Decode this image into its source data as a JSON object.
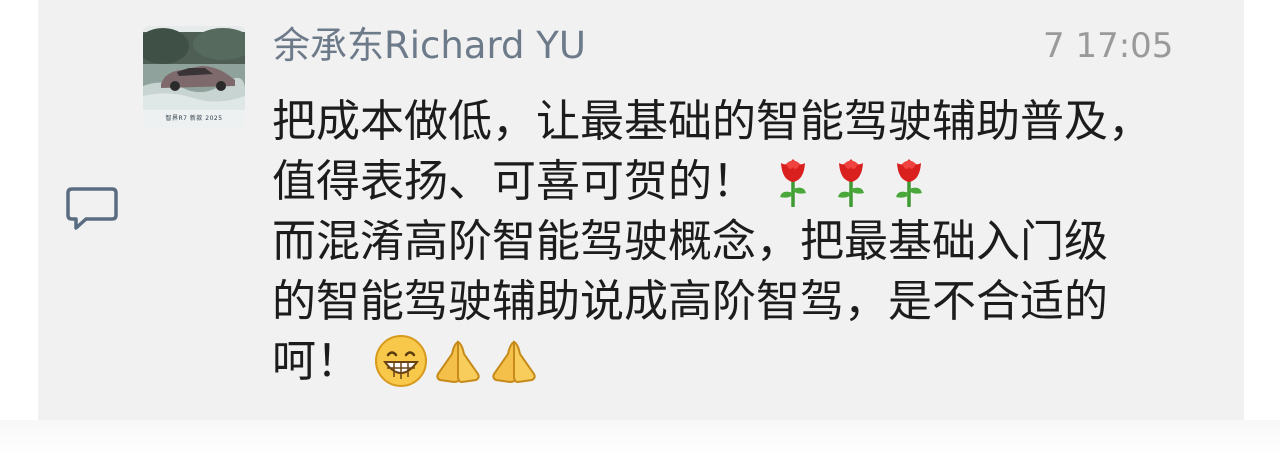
{
  "post": {
    "sender_name": "余承东Richard YU",
    "time": "7 17:05",
    "avatar_caption": "智界R7 新款 2025",
    "message_lines": [
      "把成本做低，让最基础的智能驾驶辅助普及，",
      "值得表扬、可喜可贺的！",
      "而混淆高阶智能驾驶概念，把最基础入门级",
      "的智能驾驶辅助说成高阶智驾，是不合适的",
      "呵！"
    ]
  },
  "icons": {
    "avatar": "car-photo-avatar",
    "comment": "comment-icon",
    "rose": "rose-emoji",
    "grin": "grin-emoji",
    "pray": "pray-emoji"
  },
  "colors": {
    "card_background": "#f1f1f1",
    "name_color": "#6c7a8a",
    "time_color": "#9a9a9a",
    "text_color": "#1c1c1c",
    "icon_color": "#5a6c80"
  }
}
